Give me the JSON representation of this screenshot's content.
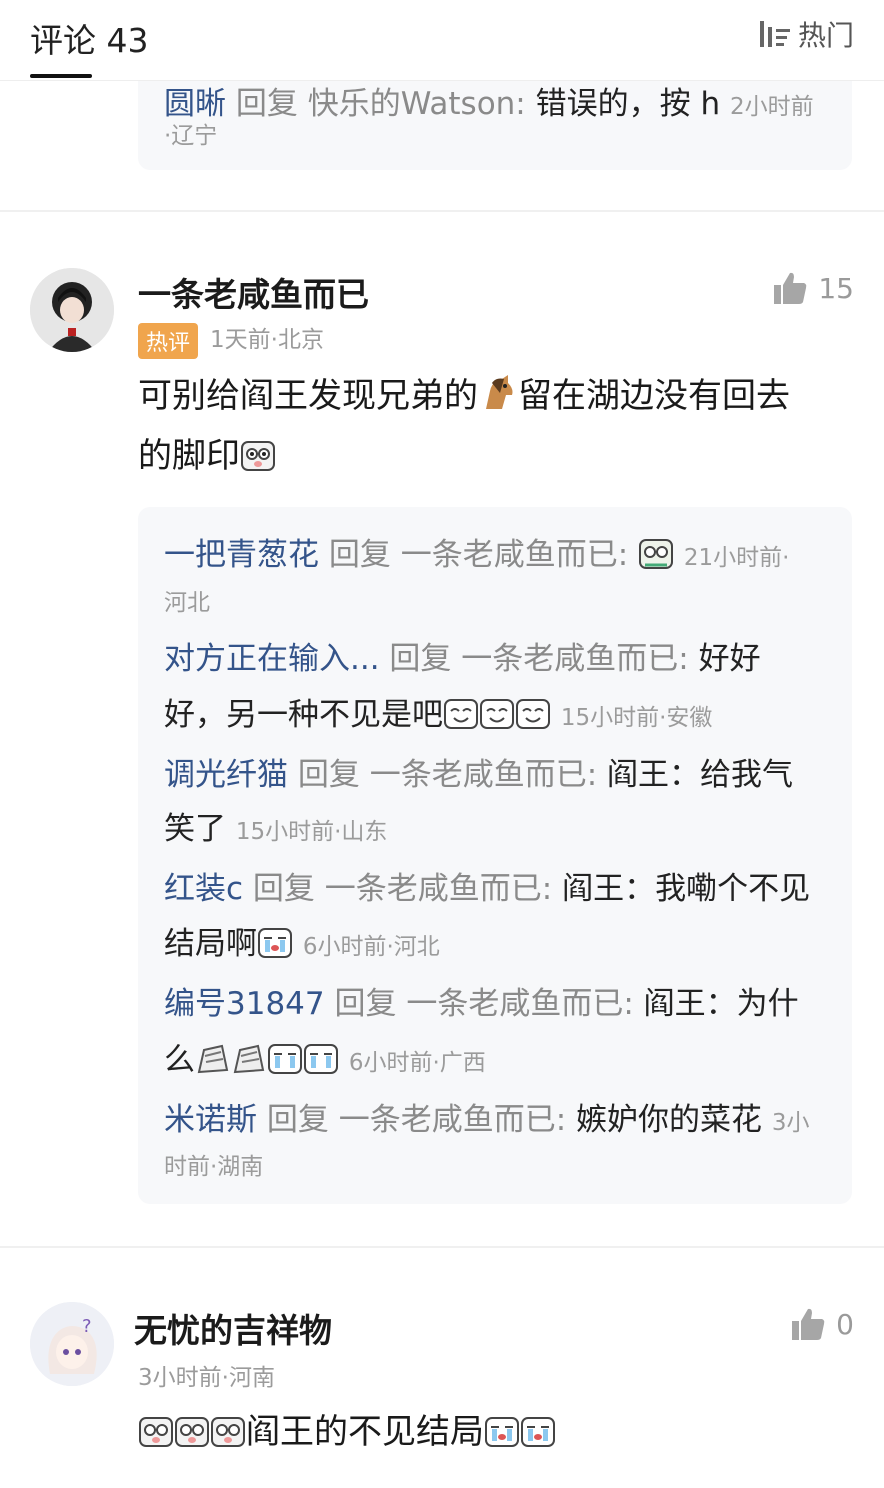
{
  "header": {
    "title": "评论 43",
    "sort_label": "热门"
  },
  "top_reply": {
    "user": "圆晰",
    "reply_word": "回复",
    "target": "快乐的Watson:",
    "text": "错误的，按 h",
    "time": "2小时前",
    "location": "·辽宁"
  },
  "comment1": {
    "user": "一条老咸鱼而已",
    "badge": "热评",
    "meta": "1天前·北京",
    "likes": "15",
    "text_line1": "可别给阎王发现兄弟的",
    "text_line1b": "留在湖边没有回去",
    "text_line2": "的脚印",
    "replies": [
      {
        "user": "一把青葱花",
        "reply_word": "回复",
        "target": "一条老咸鱼而已:",
        "time": "21小时前·",
        "loc": "河北"
      },
      {
        "user": "对方正在输入...",
        "reply_word": "回复",
        "target": "一条老咸鱼而已:",
        "text_a": "好好",
        "text_b": "好，另一种不见是吧",
        "meta": "15小时前·安徽"
      },
      {
        "user": "调光纤猫",
        "reply_word": "回复",
        "target": "一条老咸鱼而已:",
        "text_a": "阎王：给我气",
        "text_b": "笑了",
        "meta": "15小时前·山东"
      },
      {
        "user": "红装c",
        "reply_word": "回复",
        "target": "一条老咸鱼而已:",
        "text_a": "阎王：我嘞个不见",
        "text_b": "结局啊",
        "meta": "6小时前·河北"
      },
      {
        "user": "编号31847",
        "reply_word": "回复",
        "target": "一条老咸鱼而已:",
        "text_a": "阎王：为什",
        "text_b": "么",
        "meta": "6小时前·广西"
      },
      {
        "user": "米诺斯",
        "reply_word": "回复",
        "target": "一条老咸鱼而已:",
        "text_a": "嫉妒你的菜花",
        "time_a": "3小",
        "meta_b": "时前·湖南"
      }
    ]
  },
  "comment2": {
    "user": "无忧的吉祥物",
    "meta": "3小时前·河南",
    "likes": "0",
    "text": "阎王的不见结局"
  }
}
